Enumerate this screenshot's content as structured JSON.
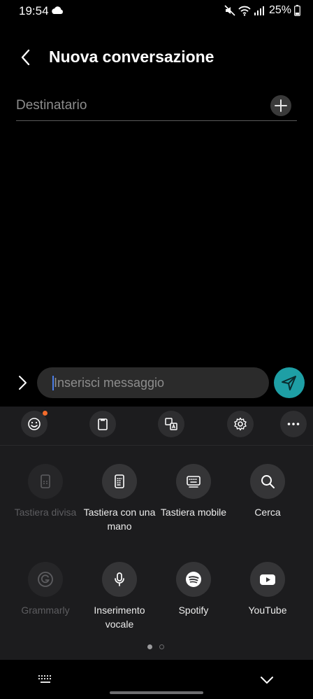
{
  "status_bar": {
    "time": "19:54",
    "battery": "25%"
  },
  "header": {
    "title": "Nuova conversazione"
  },
  "recipient": {
    "placeholder": "Destinatario"
  },
  "composer": {
    "placeholder": "Inserisci messaggio"
  },
  "keyboard_toolbar": {
    "icons": [
      "emoji-icon",
      "clipboard-icon",
      "translate-icon",
      "settings-icon",
      "more-icon"
    ]
  },
  "grid": {
    "row1": [
      {
        "label": "Tastiera divisa",
        "enabled": false
      },
      {
        "label": "Tastiera con una mano",
        "enabled": true
      },
      {
        "label": "Tastiera mobile",
        "enabled": true
      },
      {
        "label": "Cerca",
        "enabled": true
      }
    ],
    "row2": [
      {
        "label": "Grammarly",
        "enabled": false
      },
      {
        "label": "Inserimento vocale",
        "enabled": true
      },
      {
        "label": "Spotify",
        "enabled": true
      },
      {
        "label": "YouTube",
        "enabled": true
      }
    ]
  },
  "pagination": {
    "current": 1,
    "total": 2
  },
  "colors": {
    "background": "#000000",
    "panel": "#1c1c1e",
    "send_button": "#1e9fa5",
    "notification_dot": "#f36b2b",
    "caret": "#4a7de8"
  }
}
